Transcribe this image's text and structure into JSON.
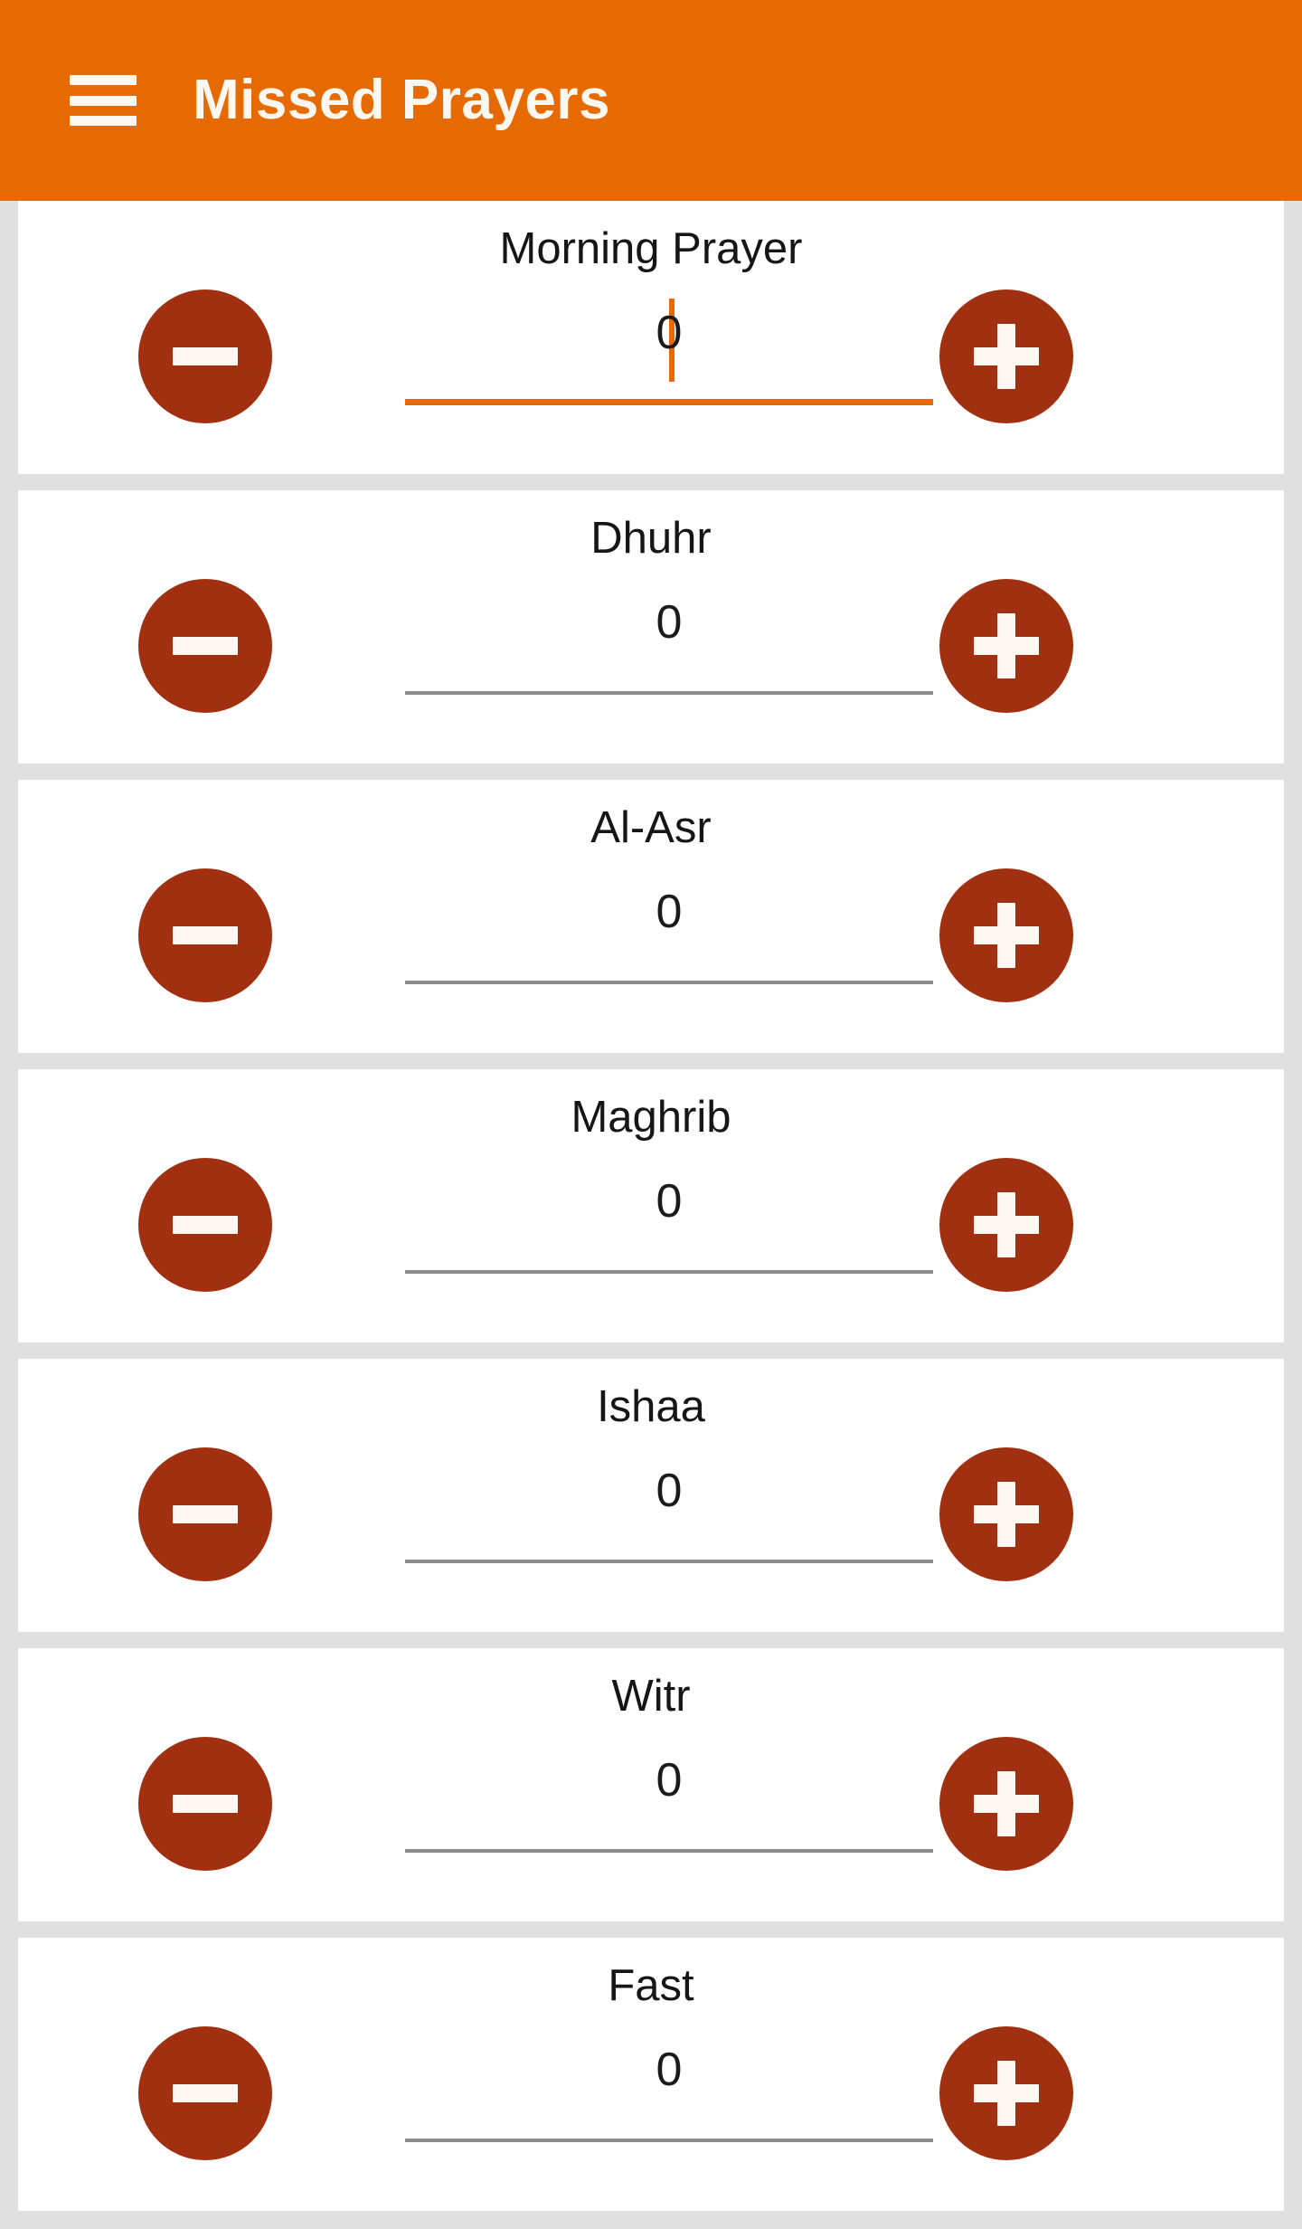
{
  "colors": {
    "brand_orange": "#e66a00",
    "button_red": "#a0300f",
    "page_background": "#e0e0e0",
    "card_background": "#ffffff",
    "underline_inactive": "#8a8a8a",
    "text_primary": "#161616",
    "appbar_text": "#fdf7f2"
  },
  "appbar": {
    "title": "Missed Prayers",
    "menu_icon": "hamburger-menu-icon"
  },
  "icons": {
    "minus": "minus-icon",
    "plus": "plus-icon"
  },
  "cards": [
    {
      "label": "Morning Prayer",
      "value": "0",
      "focused": true,
      "decrement_label": "−",
      "increment_label": "+"
    },
    {
      "label": "Dhuhr",
      "value": "0",
      "focused": false,
      "decrement_label": "−",
      "increment_label": "+"
    },
    {
      "label": "Al-Asr",
      "value": "0",
      "focused": false,
      "decrement_label": "−",
      "increment_label": "+"
    },
    {
      "label": "Maghrib",
      "value": "0",
      "focused": false,
      "decrement_label": "−",
      "increment_label": "+"
    },
    {
      "label": "Ishaa",
      "value": "0",
      "focused": false,
      "decrement_label": "−",
      "increment_label": "+"
    },
    {
      "label": "Witr",
      "value": "0",
      "focused": false,
      "decrement_label": "−",
      "increment_label": "+"
    },
    {
      "label": "Fast",
      "value": "0",
      "focused": false,
      "decrement_label": "−",
      "increment_label": "+"
    }
  ]
}
